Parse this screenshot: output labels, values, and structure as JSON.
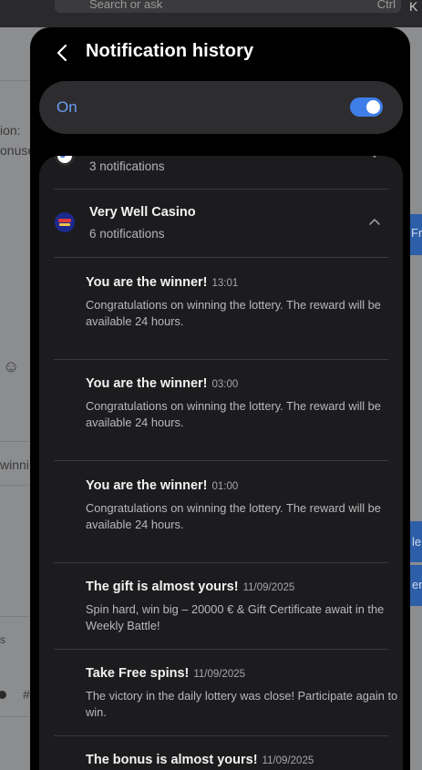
{
  "background": {
    "search_placeholder": "Search or ask",
    "search_shortcut": "Ctrl",
    "edge_letter": "K",
    "left_snippets": [
      "ion:",
      "onuse",
      "winni",
      "s",
      "#"
    ],
    "right_snippets": [
      "Fre",
      "le",
      "en"
    ]
  },
  "header": {
    "title": "Notification history",
    "back_icon": "chevron-left-icon"
  },
  "toggle": {
    "label": "On",
    "state": "on",
    "accent": "#3f7ee8"
  },
  "apps": [
    {
      "name": "",
      "count": "3 notifications",
      "icon": "app-icon-partial",
      "expanded": false
    },
    {
      "name": "Very Well Casino",
      "count": "6 notifications",
      "icon": "casino-logo-icon",
      "expanded": true
    }
  ],
  "notifications": [
    {
      "title": "You are the winner!",
      "time": "13:01",
      "body": "Congratulations on winning the lottery. The reward will be available 24 hours."
    },
    {
      "title": "You are the winner!",
      "time": "03:00",
      "body": "Congratulations on winning the lottery. The reward will be available 24 hours."
    },
    {
      "title": "You are the winner!",
      "time": "01:00",
      "body": "Congratulations on winning the lottery. The reward will be available 24 hours."
    },
    {
      "title": "The gift is almost yours!",
      "time": "11/09/2025",
      "body": "Spin hard, win big – 20000 € & Gift Certificate await in the Weekly Battle!"
    },
    {
      "title": "Take Free spins!",
      "time": "11/09/2025",
      "body": "The victory in the daily lottery was close! Participate again to win."
    },
    {
      "title": "The bonus is almost yours!",
      "time": "11/09/2025",
      "body": ""
    }
  ]
}
